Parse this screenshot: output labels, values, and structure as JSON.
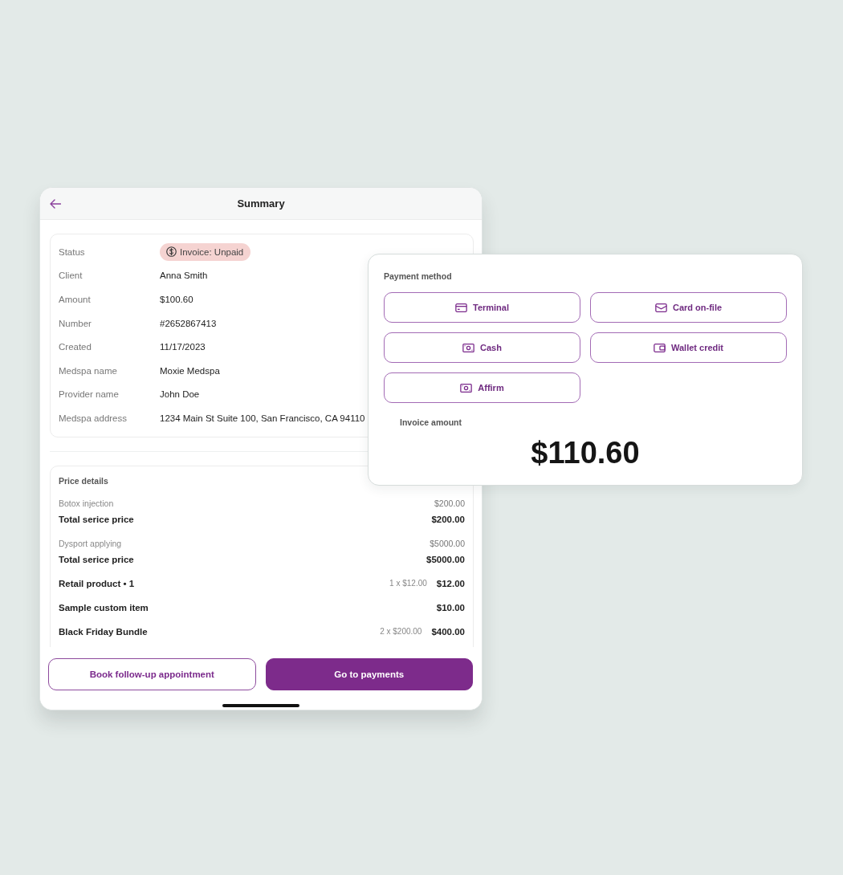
{
  "screen": {
    "title": "Summary"
  },
  "details": [
    {
      "label": "Status",
      "value": "Invoice: Unpaid",
      "kind": "badge"
    },
    {
      "label": "Client",
      "value": "Anna Smith",
      "kind": "text"
    },
    {
      "label": "Amount",
      "value": "$100.60",
      "kind": "text"
    },
    {
      "label": "Number",
      "value": "#2652867413",
      "kind": "text"
    },
    {
      "label": "Created",
      "value": "11/17/2023",
      "kind": "text"
    },
    {
      "label": "Medspa name",
      "value": "Moxie Medspa",
      "kind": "text"
    },
    {
      "label": "Provider name",
      "value": "John Doe",
      "kind": "text"
    },
    {
      "label": "Medspa address",
      "value": "1234 Main St Suite 100, San Francisco, CA 94110",
      "kind": "text"
    }
  ],
  "price_details": {
    "title": "Price details",
    "rows": [
      {
        "kind": "service",
        "label": "Botox injection",
        "amount": "$200.00"
      },
      {
        "kind": "total",
        "label": "Total serice price",
        "amount": "$200.00"
      },
      {
        "kind": "service",
        "label": "Dysport applying",
        "amount": "$5000.00"
      },
      {
        "kind": "total",
        "label": "Total serice price",
        "amount": "$5000.00"
      },
      {
        "kind": "item",
        "label": "Retail product • 1",
        "quantity": "1 x $12.00",
        "amount": "$12.00"
      },
      {
        "kind": "item",
        "label": "Sample custom item",
        "amount": "$10.00"
      },
      {
        "kind": "item",
        "label": "Black Friday Bundle",
        "quantity": "2 x $200.00",
        "amount": "$400.00"
      }
    ]
  },
  "footer_buttons": [
    {
      "label": "Book follow-up appointment",
      "kind": "secondary"
    },
    {
      "label": "Go to payments",
      "kind": "primary"
    }
  ],
  "payment_panel": {
    "title": "Payment method",
    "methods": [
      {
        "label": "Terminal",
        "kind": "card"
      },
      {
        "label": "Card on-file",
        "kind": "envelope"
      },
      {
        "label": "Cash",
        "kind": "cash"
      },
      {
        "label": "Wallet credit",
        "kind": "wallet"
      },
      {
        "label": "Affirm",
        "kind": "cash"
      }
    ],
    "invoice_label": "Invoice amount",
    "invoice_amount": "$110.60"
  }
}
